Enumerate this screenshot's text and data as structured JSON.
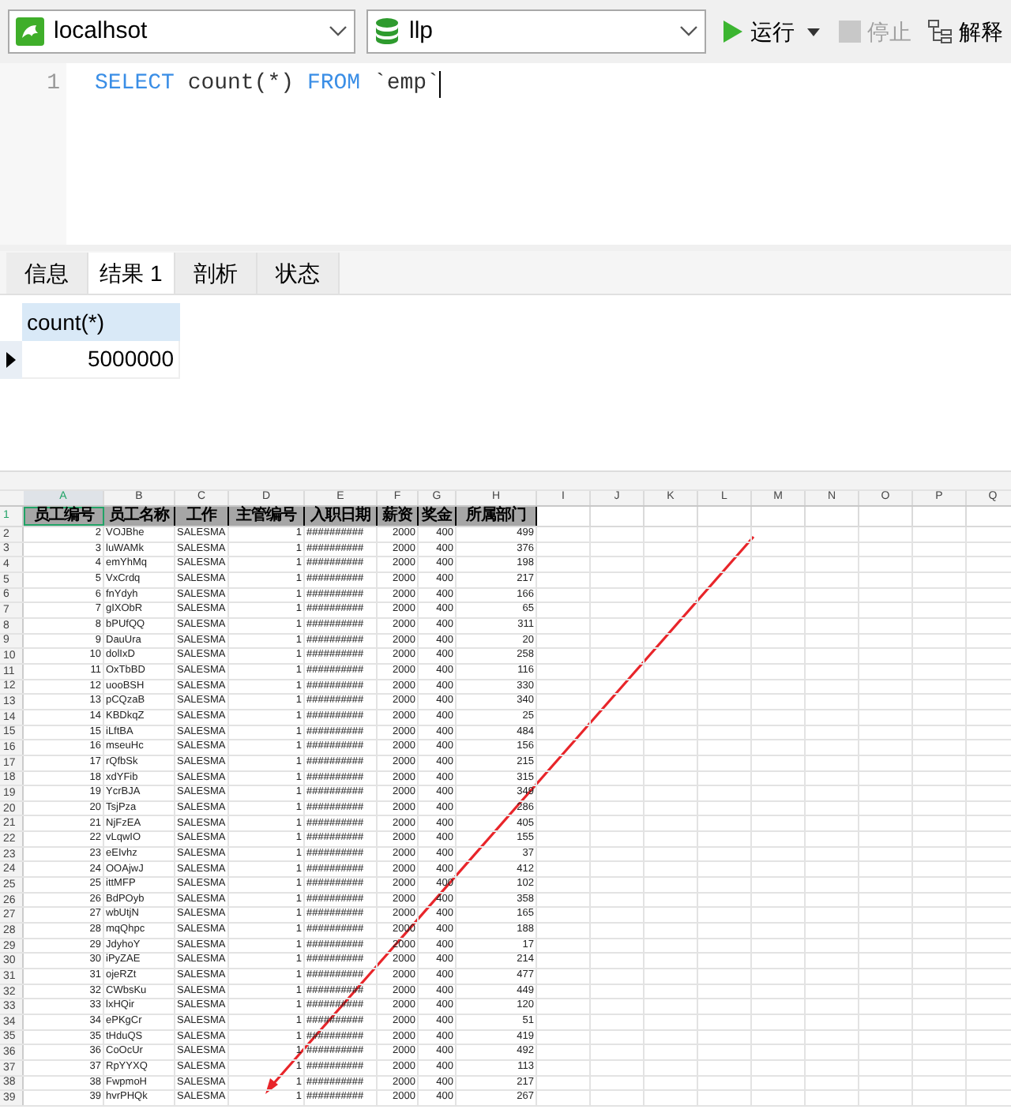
{
  "toolbar": {
    "connection": "localhsot",
    "database": "llp",
    "run": "运行",
    "stop": {
      "label": "停止",
      "disabled": true
    },
    "explain": "解释"
  },
  "editor": {
    "lines": [
      {
        "number": "1",
        "tokens": [
          {
            "kind": "keyword",
            "text": "SELECT"
          },
          {
            "kind": "plain",
            "text": " count(*) "
          },
          {
            "kind": "keyword",
            "text": "FROM"
          },
          {
            "kind": "plain",
            "text": " `emp`"
          }
        ]
      }
    ]
  },
  "result_tabs": [
    {
      "label": "信息",
      "selected": false
    },
    {
      "label": "结果 1",
      "selected": true
    },
    {
      "label": "剖析",
      "selected": false
    },
    {
      "label": "状态",
      "selected": false
    }
  ],
  "result_grid": {
    "columns": [
      "count(*)"
    ],
    "rows": [
      [
        "5000000"
      ]
    ]
  },
  "sheet": {
    "columns": [
      {
        "label": "A",
        "selected": true
      },
      {
        "label": "B",
        "selected": false
      },
      {
        "label": "C",
        "selected": false
      },
      {
        "label": "D",
        "selected": false
      },
      {
        "label": "E",
        "selected": false
      },
      {
        "label": "F",
        "selected": false
      },
      {
        "label": "G",
        "selected": false
      },
      {
        "label": "H",
        "selected": false
      },
      {
        "label": "I",
        "selected": false
      },
      {
        "label": "J",
        "selected": false
      },
      {
        "label": "K",
        "selected": false
      },
      {
        "label": "L",
        "selected": false
      },
      {
        "label": "M",
        "selected": false
      },
      {
        "label": "N",
        "selected": false
      },
      {
        "label": "O",
        "selected": false
      },
      {
        "label": "P",
        "selected": false
      },
      {
        "label": "Q",
        "selected": false
      }
    ],
    "header_row": {
      "number": "1",
      "cells": [
        "员工编号",
        "员工名称",
        "工作",
        "主管编号",
        "入职日期",
        "薪资",
        "奖金",
        "所属部门"
      ]
    },
    "rows": [
      {
        "number": "2",
        "cells": [
          "2",
          "VOJBhe",
          "SALESMA",
          "1",
          "##########",
          "2000",
          "400",
          "499"
        ]
      },
      {
        "number": "3",
        "cells": [
          "3",
          "luWAMk",
          "SALESMA",
          "1",
          "##########",
          "2000",
          "400",
          "376"
        ]
      },
      {
        "number": "4",
        "cells": [
          "4",
          "emYhMq",
          "SALESMA",
          "1",
          "##########",
          "2000",
          "400",
          "198"
        ]
      },
      {
        "number": "5",
        "cells": [
          "5",
          "VxCrdq",
          "SALESMA",
          "1",
          "##########",
          "2000",
          "400",
          "217"
        ]
      },
      {
        "number": "6",
        "cells": [
          "6",
          "fnYdyh",
          "SALESMA",
          "1",
          "##########",
          "2000",
          "400",
          "166"
        ]
      },
      {
        "number": "7",
        "cells": [
          "7",
          "gIXObR",
          "SALESMA",
          "1",
          "##########",
          "2000",
          "400",
          "65"
        ]
      },
      {
        "number": "8",
        "cells": [
          "8",
          "bPUfQQ",
          "SALESMA",
          "1",
          "##########",
          "2000",
          "400",
          "311"
        ]
      },
      {
        "number": "9",
        "cells": [
          "9",
          "DauUra",
          "SALESMA",
          "1",
          "##########",
          "2000",
          "400",
          "20"
        ]
      },
      {
        "number": "10",
        "cells": [
          "10",
          "dolIxD",
          "SALESMA",
          "1",
          "##########",
          "2000",
          "400",
          "258"
        ]
      },
      {
        "number": "11",
        "cells": [
          "11",
          "OxTbBD",
          "SALESMA",
          "1",
          "##########",
          "2000",
          "400",
          "116"
        ]
      },
      {
        "number": "12",
        "cells": [
          "12",
          "uooBSH",
          "SALESMA",
          "1",
          "##########",
          "2000",
          "400",
          "330"
        ]
      },
      {
        "number": "13",
        "cells": [
          "13",
          "pCQzaB",
          "SALESMA",
          "1",
          "##########",
          "2000",
          "400",
          "340"
        ]
      },
      {
        "number": "14",
        "cells": [
          "14",
          "KBDkqZ",
          "SALESMA",
          "1",
          "##########",
          "2000",
          "400",
          "25"
        ]
      },
      {
        "number": "15",
        "cells": [
          "15",
          "iLftBA",
          "SALESMA",
          "1",
          "##########",
          "2000",
          "400",
          "484"
        ]
      },
      {
        "number": "16",
        "cells": [
          "16",
          "mseuHc",
          "SALESMA",
          "1",
          "##########",
          "2000",
          "400",
          "156"
        ]
      },
      {
        "number": "17",
        "cells": [
          "17",
          "rQfbSk",
          "SALESMA",
          "1",
          "##########",
          "2000",
          "400",
          "215"
        ]
      },
      {
        "number": "18",
        "cells": [
          "18",
          "xdYFib",
          "SALESMA",
          "1",
          "##########",
          "2000",
          "400",
          "315"
        ]
      },
      {
        "number": "19",
        "cells": [
          "19",
          "YcrBJA",
          "SALESMA",
          "1",
          "##########",
          "2000",
          "400",
          "349"
        ]
      },
      {
        "number": "20",
        "cells": [
          "20",
          "TsjPza",
          "SALESMA",
          "1",
          "##########",
          "2000",
          "400",
          "286"
        ]
      },
      {
        "number": "21",
        "cells": [
          "21",
          "NjFzEA",
          "SALESMA",
          "1",
          "##########",
          "2000",
          "400",
          "405"
        ]
      },
      {
        "number": "22",
        "cells": [
          "22",
          "vLqwIO",
          "SALESMA",
          "1",
          "##########",
          "2000",
          "400",
          "155"
        ]
      },
      {
        "number": "23",
        "cells": [
          "23",
          "eEIvhz",
          "SALESMA",
          "1",
          "##########",
          "2000",
          "400",
          "37"
        ]
      },
      {
        "number": "24",
        "cells": [
          "24",
          "OOAjwJ",
          "SALESMA",
          "1",
          "##########",
          "2000",
          "400",
          "412"
        ]
      },
      {
        "number": "25",
        "cells": [
          "25",
          "ittMFP",
          "SALESMA",
          "1",
          "##########",
          "2000",
          "400",
          "102"
        ]
      },
      {
        "number": "26",
        "cells": [
          "26",
          "BdPOyb",
          "SALESMA",
          "1",
          "##########",
          "2000",
          "400",
          "358"
        ]
      },
      {
        "number": "27",
        "cells": [
          "27",
          "wbUtjN",
          "SALESMA",
          "1",
          "##########",
          "2000",
          "400",
          "165"
        ]
      },
      {
        "number": "28",
        "cells": [
          "28",
          "mqQhpc",
          "SALESMA",
          "1",
          "##########",
          "2000",
          "400",
          "188"
        ]
      },
      {
        "number": "29",
        "cells": [
          "29",
          "JdyhoY",
          "SALESMA",
          "1",
          "##########",
          "2000",
          "400",
          "17"
        ]
      },
      {
        "number": "30",
        "cells": [
          "30",
          "iPyZAE",
          "SALESMA",
          "1",
          "##########",
          "2000",
          "400",
          "214"
        ]
      },
      {
        "number": "31",
        "cells": [
          "31",
          "ojeRZt",
          "SALESMA",
          "1",
          "##########",
          "2000",
          "400",
          "477"
        ]
      },
      {
        "number": "32",
        "cells": [
          "32",
          "CWbsKu",
          "SALESMA",
          "1",
          "##########",
          "2000",
          "400",
          "449"
        ]
      },
      {
        "number": "33",
        "cells": [
          "33",
          "lxHQir",
          "SALESMA",
          "1",
          "##########",
          "2000",
          "400",
          "120"
        ]
      },
      {
        "number": "34",
        "cells": [
          "34",
          "ePKgCr",
          "SALESMA",
          "1",
          "##########",
          "2000",
          "400",
          "51"
        ]
      },
      {
        "number": "35",
        "cells": [
          "35",
          "tHduQS",
          "SALESMA",
          "1",
          "##########",
          "2000",
          "400",
          "419"
        ]
      },
      {
        "number": "36",
        "cells": [
          "36",
          "CoOcUr",
          "SALESMA",
          "1",
          "##########",
          "2000",
          "400",
          "492"
        ]
      },
      {
        "number": "37",
        "cells": [
          "37",
          "RpYYXQ",
          "SALESMA",
          "1",
          "##########",
          "2000",
          "400",
          "113"
        ]
      },
      {
        "number": "38",
        "cells": [
          "38",
          "FwpmoH",
          "SALESMA",
          "1",
          "##########",
          "2000",
          "400",
          "217"
        ]
      },
      {
        "number": "39",
        "cells": [
          "39",
          "hvrPHQk",
          "SALESMA",
          "1",
          "##########",
          "2000",
          "400",
          "267"
        ]
      }
    ]
  }
}
